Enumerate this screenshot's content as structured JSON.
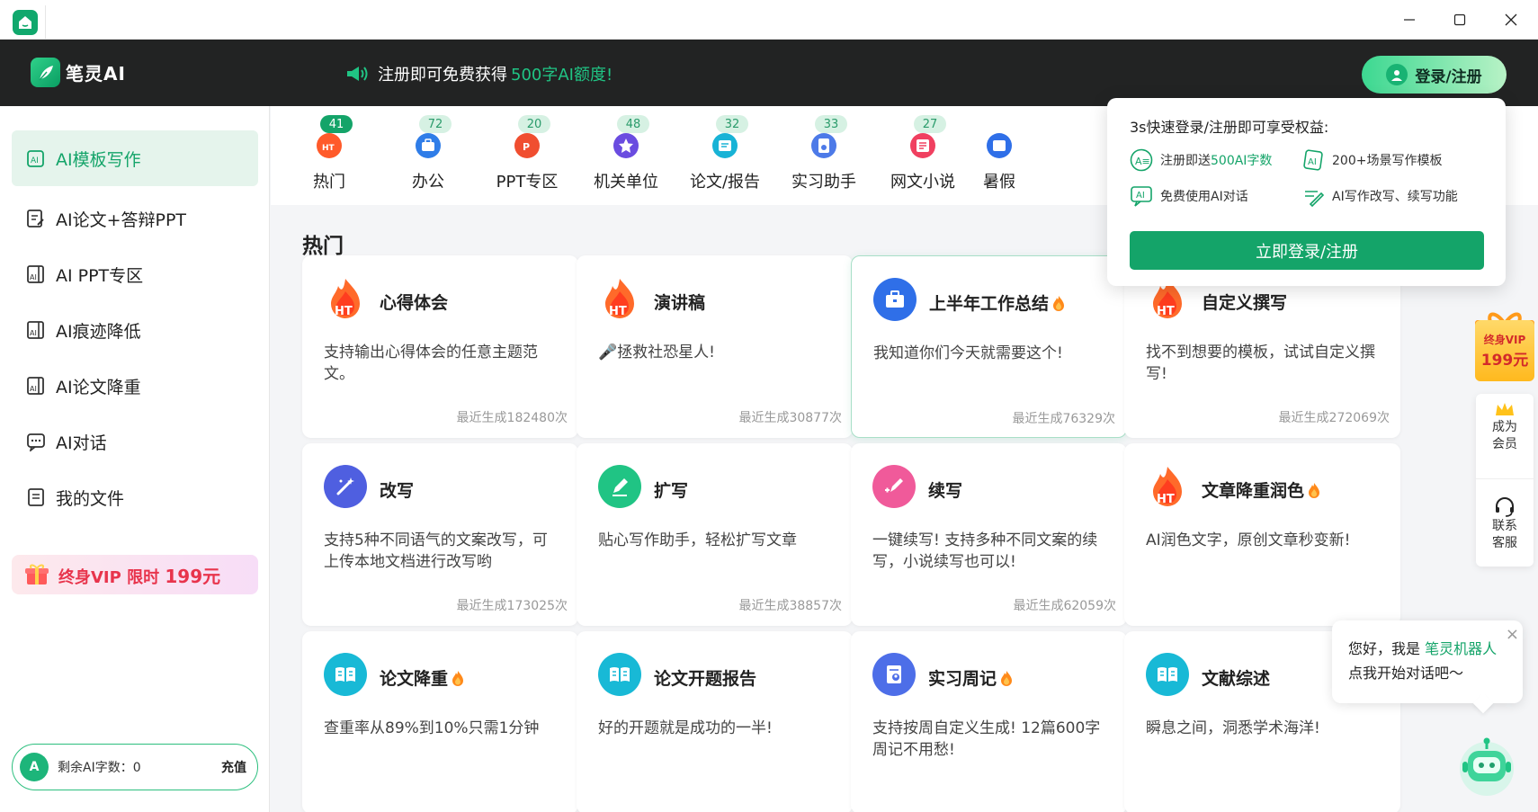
{
  "window": {
    "minimize": "─",
    "maximize": "☐",
    "close": "✕"
  },
  "header": {
    "app_name": "笔灵AI",
    "promo_text": "注册即可免费获得",
    "promo_highlight": "500字AI额度!",
    "login_button": "登录/注册"
  },
  "sidebar": {
    "items": [
      {
        "label": "AI模板写作",
        "icon": "template-icon",
        "active": true
      },
      {
        "label": "AI论文+答辩PPT",
        "icon": "paper-icon",
        "active": false
      },
      {
        "label": "AI PPT专区",
        "icon": "ppt-icon",
        "active": false
      },
      {
        "label": "AI痕迹降低",
        "icon": "trace-icon",
        "active": false
      },
      {
        "label": "AI论文降重",
        "icon": "dedupe-icon",
        "active": false
      },
      {
        "label": "AI对话",
        "icon": "chat-icon",
        "active": false
      },
      {
        "label": "我的文件",
        "icon": "file-icon",
        "active": false
      }
    ],
    "vip_banner": {
      "label": "终身VIP 限时",
      "price": "199元"
    },
    "quota": {
      "icon_text": "A",
      "label": "剩余AI字数：0",
      "recharge": "充值"
    }
  },
  "categories": [
    {
      "count": "41",
      "label": "热门",
      "color": "#ff5a2a",
      "active": true
    },
    {
      "count": "72",
      "label": "办公",
      "color": "#2f7de8",
      "active": false
    },
    {
      "count": "20",
      "label": "PPT专区",
      "color": "#f04e30",
      "active": false
    },
    {
      "count": "48",
      "label": "机关单位",
      "color": "#6a4ce0",
      "active": false
    },
    {
      "count": "32",
      "label": "论文/报告",
      "color": "#18b3d6",
      "active": false
    },
    {
      "count": "33",
      "label": "实习助手",
      "color": "#4d7ae8",
      "active": false
    },
    {
      "count": "27",
      "label": "网文小说",
      "color": "#f04060",
      "active": false
    },
    {
      "count": "",
      "label": "暑假",
      "color": "#2f6fe8",
      "active": false
    }
  ],
  "section_title": "热门",
  "cards": [
    {
      "title": "心得体会",
      "hot": false,
      "desc": "支持输出心得体会的任意主题范文。",
      "stat": "最近生成182480次",
      "icon": "ht-fire-icon"
    },
    {
      "title": "演讲稿",
      "hot": false,
      "desc": "🎤拯救社恐星人!",
      "stat": "最近生成30877次",
      "icon": "ht-fire-icon"
    },
    {
      "title": "上半年工作总结",
      "hot": true,
      "desc": "我知道你们今天就需要这个!",
      "stat": "最近生成76329次",
      "icon": "briefcase-icon"
    },
    {
      "title": "自定义撰写",
      "hot": false,
      "desc": "找不到想要的模板，试试自定义撰写!",
      "stat": "最近生成272069次",
      "icon": "ht-fire-icon"
    },
    {
      "title": "改写",
      "hot": false,
      "desc": "支持5种不同语气的文案改写，可上传本地文档进行改写哟",
      "stat": "最近生成173025次",
      "icon": "magic-wand-icon"
    },
    {
      "title": "扩写",
      "hot": false,
      "desc": "贴心写作助手，轻松扩写文章",
      "stat": "最近生成38857次",
      "icon": "pencil-icon"
    },
    {
      "title": "续写",
      "hot": false,
      "desc": "一键续写! 支持多种不同文案的续写，小说续写也可以!",
      "stat": "最近生成62059次",
      "icon": "continue-write-icon"
    },
    {
      "title": "文章降重润色",
      "hot": true,
      "desc": "AI润色文字，原创文章秒变新!",
      "stat": "",
      "icon": "ht-fire-icon"
    },
    {
      "title": "论文降重",
      "hot": true,
      "desc": "查重率从89%到10%只需1分钟",
      "stat": "",
      "icon": "book-icon"
    },
    {
      "title": "论文开题报告",
      "hot": false,
      "desc": "好的开题就是成功的一半!",
      "stat": "",
      "icon": "book-icon"
    },
    {
      "title": "实习周记",
      "hot": true,
      "desc": "支持按周自定义生成! 12篇600字周记不用愁!",
      "stat": "",
      "icon": "intern-icon"
    },
    {
      "title": "文献综述",
      "hot": false,
      "desc": "瞬息之间，洞悉学术海洋!",
      "stat": "",
      "icon": "book-icon"
    }
  ],
  "popup": {
    "title": "3s快速登录/注册即可享受权益:",
    "features": [
      {
        "pre": "注册即送",
        "hl": "500AI字数",
        "icon": "ai-text-icon"
      },
      {
        "pre": "200+场景写作模板",
        "hl": "",
        "icon": "ai-template-icon"
      },
      {
        "pre": "免费使用AI对话",
        "hl": "",
        "icon": "ai-chat-icon"
      },
      {
        "pre": "AI写作改写、续写功能",
        "hl": "",
        "icon": "rewrite-icon"
      }
    ],
    "cta": "立即登录/注册"
  },
  "vip_float": {
    "line1": "终身VIP",
    "line2": "199元"
  },
  "service": {
    "member_line1": "成为",
    "member_line2": "会员",
    "contact_line1": "联系",
    "contact_line2": "客服"
  },
  "chat": {
    "greet": "您好，我是",
    "name": "笔灵机器人",
    "line2": "点我开始对话吧～",
    "close": "×"
  },
  "colors": {
    "brand": "#14a469",
    "header_bg": "#222323",
    "hot": "#ff7a1a",
    "vip_red": "#e8344c"
  }
}
